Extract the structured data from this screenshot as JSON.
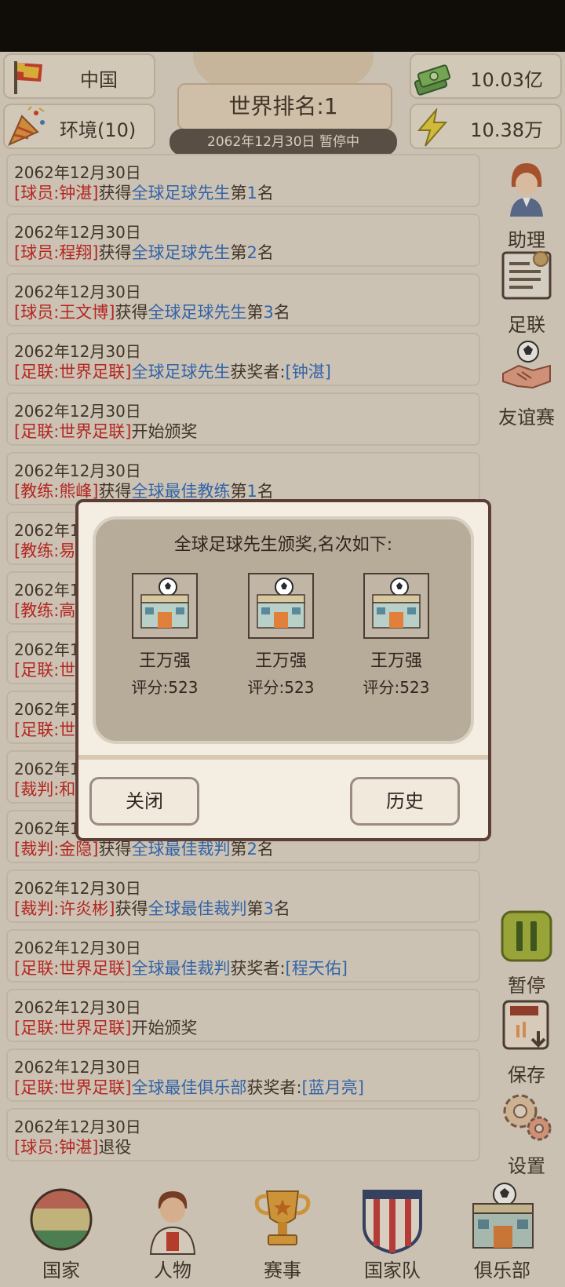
{
  "header": {
    "country": "中国",
    "environment": "环境(10)",
    "world_rank": "世界排名:1",
    "date_status": "2062年12月30日  暂停中",
    "money": "10.03亿",
    "energy": "10.38万"
  },
  "feed": [
    {
      "date": "2062年12月30日",
      "parts": [
        {
          "t": "[球员:钟湛]",
          "c": "red"
        },
        {
          "t": "获得",
          "c": "dark"
        },
        {
          "t": "全球足球先生",
          "c": "blue"
        },
        {
          "t": "第",
          "c": "dark"
        },
        {
          "t": "1",
          "c": "blue"
        },
        {
          "t": "名",
          "c": "dark"
        }
      ]
    },
    {
      "date": "2062年12月30日",
      "parts": [
        {
          "t": "[球员:程翔]",
          "c": "red"
        },
        {
          "t": "获得",
          "c": "dark"
        },
        {
          "t": "全球足球先生",
          "c": "blue"
        },
        {
          "t": "第",
          "c": "dark"
        },
        {
          "t": "2",
          "c": "blue"
        },
        {
          "t": "名",
          "c": "dark"
        }
      ]
    },
    {
      "date": "2062年12月30日",
      "parts": [
        {
          "t": "[球员:王文博]",
          "c": "red"
        },
        {
          "t": "获得",
          "c": "dark"
        },
        {
          "t": "全球足球先生",
          "c": "blue"
        },
        {
          "t": "第",
          "c": "dark"
        },
        {
          "t": "3",
          "c": "blue"
        },
        {
          "t": "名",
          "c": "dark"
        }
      ]
    },
    {
      "date": "2062年12月30日",
      "parts": [
        {
          "t": "[足联:世界足联]",
          "c": "red"
        },
        {
          "t": "全球足球先生",
          "c": "blue"
        },
        {
          "t": "获奖者:",
          "c": "dark"
        },
        {
          "t": "[钟湛]",
          "c": "blue"
        }
      ]
    },
    {
      "date": "2062年12月30日",
      "parts": [
        {
          "t": "[足联:世界足联]",
          "c": "red"
        },
        {
          "t": "开始颁奖",
          "c": "dark"
        }
      ]
    },
    {
      "date": "2062年12月30日",
      "parts": [
        {
          "t": "[教练:熊峰]",
          "c": "red"
        },
        {
          "t": "获得",
          "c": "dark"
        },
        {
          "t": "全球最佳教练",
          "c": "blue"
        },
        {
          "t": "第",
          "c": "dark"
        },
        {
          "t": "1",
          "c": "blue"
        },
        {
          "t": "名",
          "c": "dark"
        }
      ]
    },
    {
      "date": "2062年1",
      "parts": [
        {
          "t": "[教练:易",
          "c": "red"
        }
      ]
    },
    {
      "date": "2062年1",
      "parts": [
        {
          "t": "[教练:高",
          "c": "red"
        }
      ]
    },
    {
      "date": "2062年1",
      "parts": [
        {
          "t": "[足联:世",
          "c": "red"
        }
      ]
    },
    {
      "date": "2062年1",
      "parts": [
        {
          "t": "[足联:世",
          "c": "red"
        }
      ]
    },
    {
      "date": "2062年1",
      "parts": [
        {
          "t": "[裁判:和",
          "c": "red"
        }
      ]
    },
    {
      "date": "2062年1",
      "parts": [
        {
          "t": "[裁判:金隐]",
          "c": "red"
        },
        {
          "t": "获得",
          "c": "dark"
        },
        {
          "t": "全球最佳裁判",
          "c": "blue"
        },
        {
          "t": "第",
          "c": "dark"
        },
        {
          "t": "2",
          "c": "blue"
        },
        {
          "t": "名",
          "c": "dark"
        }
      ]
    },
    {
      "date": "2062年12月30日",
      "parts": [
        {
          "t": "[裁判:许炎彬]",
          "c": "red"
        },
        {
          "t": "获得",
          "c": "dark"
        },
        {
          "t": "全球最佳裁判",
          "c": "blue"
        },
        {
          "t": "第",
          "c": "dark"
        },
        {
          "t": "3",
          "c": "blue"
        },
        {
          "t": "名",
          "c": "dark"
        }
      ]
    },
    {
      "date": "2062年12月30日",
      "parts": [
        {
          "t": "[足联:世界足联]",
          "c": "red"
        },
        {
          "t": "全球最佳裁判",
          "c": "blue"
        },
        {
          "t": "获奖者:",
          "c": "dark"
        },
        {
          "t": "[程天佑]",
          "c": "blue"
        }
      ]
    },
    {
      "date": "2062年12月30日",
      "parts": [
        {
          "t": "[足联:世界足联]",
          "c": "red"
        },
        {
          "t": "开始颁奖",
          "c": "dark"
        }
      ]
    },
    {
      "date": "2062年12月30日",
      "parts": [
        {
          "t": "[足联:世界足联]",
          "c": "red"
        },
        {
          "t": "全球最佳俱乐部",
          "c": "blue"
        },
        {
          "t": "获奖者:",
          "c": "dark"
        },
        {
          "t": "[蓝月亮]",
          "c": "blue"
        }
      ]
    },
    {
      "date": "2062年12月30日",
      "parts": [
        {
          "t": "[球员:钟湛]",
          "c": "red"
        },
        {
          "t": "退役",
          "c": "dark"
        }
      ]
    }
  ],
  "side": {
    "assistant": "助理",
    "federation": "足联",
    "friendly": "友谊赛",
    "pause": "暂停",
    "save": "保存",
    "settings": "设置"
  },
  "nav": {
    "country": "国家",
    "people": "人物",
    "events": "赛事",
    "national_team": "国家队",
    "club": "俱乐部"
  },
  "dialog": {
    "title": "全球足球先生颁奖,名次如下:",
    "winners": [
      {
        "name": "王万强",
        "score": "评分:523"
      },
      {
        "name": "王万强",
        "score": "评分:523"
      },
      {
        "name": "王万强",
        "score": "评分:523"
      }
    ],
    "close": "关闭",
    "history": "历史"
  },
  "colors": {
    "red": "#c81e1e",
    "blue": "#2a6bc2",
    "dark": "#3b3028"
  }
}
